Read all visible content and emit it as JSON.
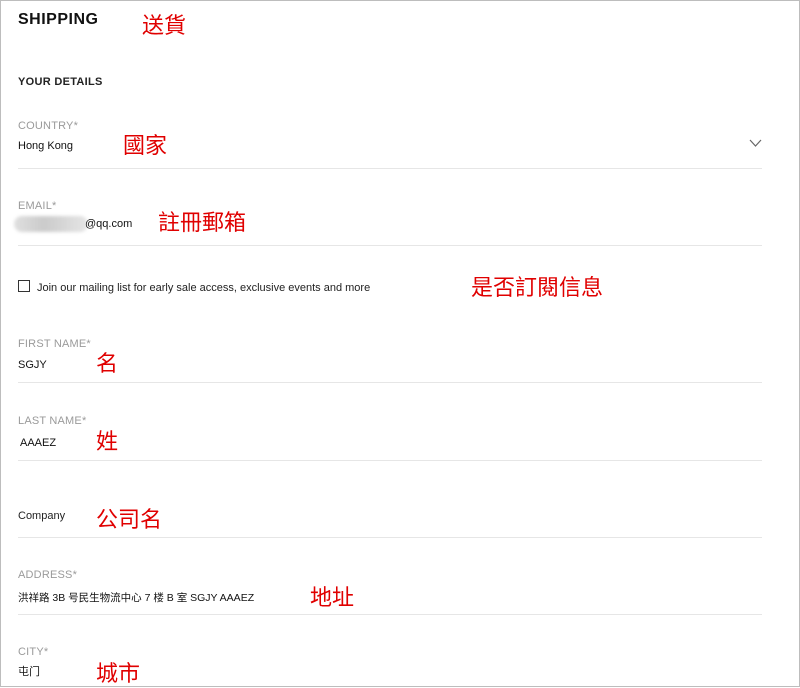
{
  "header": {
    "title": "SHIPPING",
    "title_note": "送貨"
  },
  "section": {
    "title": "YOUR DETAILS"
  },
  "country": {
    "label": "COUNTRY*",
    "value": "Hong Kong",
    "note": "國家"
  },
  "email": {
    "label": "EMAIL*",
    "value_visible": "@qq.com",
    "note": "註冊郵箱"
  },
  "mailing": {
    "label": "Join our mailing list for early sale access, exclusive events and more",
    "checked": false,
    "note": "是否訂閱信息"
  },
  "first_name": {
    "label": "FIRST NAME*",
    "value": "SGJY",
    "note": "名"
  },
  "last_name": {
    "label": "LAST NAME*",
    "value": "AAAEZ",
    "note": "姓"
  },
  "company": {
    "placeholder": "Company",
    "note": "公司名"
  },
  "address": {
    "label": "ADDRESS*",
    "value": "洪祥路 3B 号民生物流中心 7 楼 B 室 SGJY AAAEZ",
    "note": "地址"
  },
  "city": {
    "label": "CITY*",
    "value": "屯门",
    "note": "城市"
  },
  "colors": {
    "annotation": "#e00000",
    "label": "#9a9a9a",
    "divider": "#e6e6e6"
  },
  "icons": {
    "country_dropdown": "chevron-down-icon",
    "email_redaction": "redaction-blur"
  }
}
